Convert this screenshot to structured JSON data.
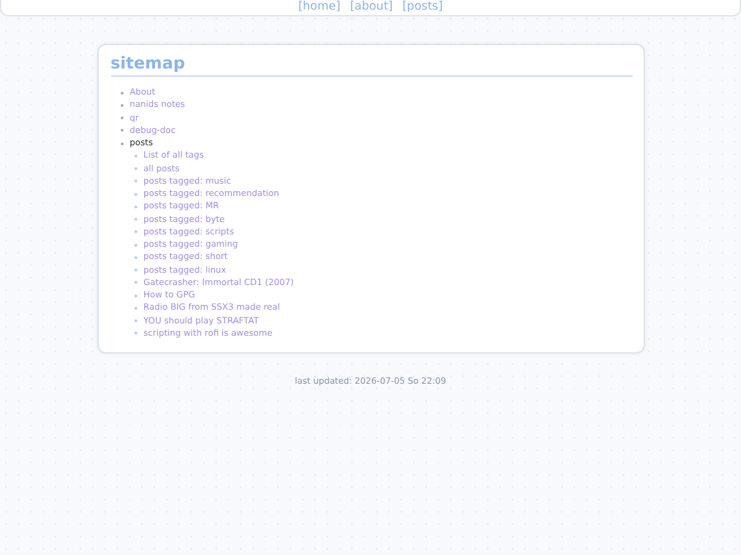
{
  "nav": {
    "links": [
      "[home]",
      "[about]",
      "[posts]"
    ]
  },
  "sitemap": {
    "title": "sitemap",
    "items": [
      {
        "label": "About",
        "kind": "link"
      },
      {
        "label": "nanids notes",
        "kind": "link"
      },
      {
        "label": "qr",
        "kind": "link"
      },
      {
        "label": "debug-doc",
        "kind": "link"
      },
      {
        "label": "posts",
        "kind": "text",
        "children": [
          {
            "label": "List of all tags",
            "kind": "link"
          },
          {
            "label": "all posts",
            "kind": "link"
          },
          {
            "label": "posts tagged: music",
            "kind": "link"
          },
          {
            "label": "posts tagged: recommendation",
            "kind": "link"
          },
          {
            "label": "posts tagged: MR",
            "kind": "link"
          },
          {
            "label": "posts tagged: byte",
            "kind": "link"
          },
          {
            "label": "posts tagged: scripts",
            "kind": "link"
          },
          {
            "label": "posts tagged: gaming",
            "kind": "link"
          },
          {
            "label": "posts tagged: short",
            "kind": "link"
          },
          {
            "label": "posts tagged: linux",
            "kind": "link"
          },
          {
            "label": "Gatecrasher: Immortal CD1 (2007)",
            "kind": "link"
          },
          {
            "label": "How to GPG",
            "kind": "link"
          },
          {
            "label": "Radio BIG from SSX3 made real",
            "kind": "link"
          },
          {
            "label": "YOU should play STRAFTAT",
            "kind": "link"
          },
          {
            "label": "scripting with rofi is awesome",
            "kind": "link"
          }
        ]
      }
    ]
  },
  "footer": {
    "text": "last updated: 2026-07-05 So 22:09"
  }
}
